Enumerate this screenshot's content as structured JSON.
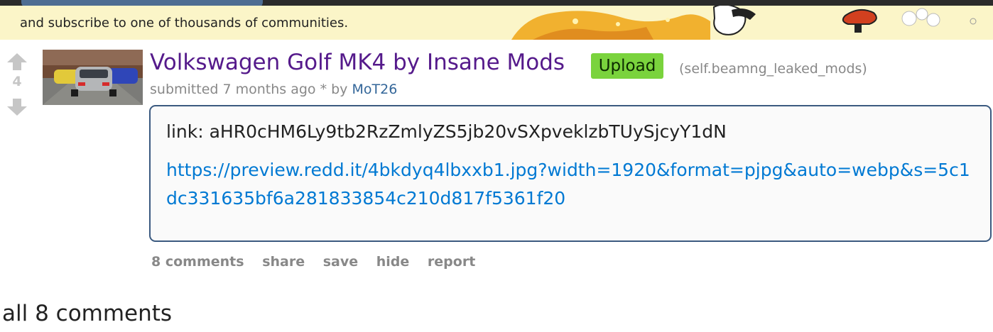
{
  "banner": {
    "text": "and subscribe to one of thousands of communities."
  },
  "post": {
    "score": "4",
    "title": "Volkswagen Golf MK4 by Insane Mods",
    "flair": "Upload",
    "domain": "self.beamng_leaked_mods",
    "tagline": {
      "prefix": "submitted 7 months ago * by",
      "author": "MoT26"
    },
    "body": {
      "line": "link: aHR0cHM6Ly9tb2RzZmlyZS5jb20vSXpveklzbTUySjcyY1dN",
      "link": "https://preview.redd.it/4bkdyq4lbxxb1.jpg?width=1920&format=pjpg&auto=webp&s=5c1dc331635bf6a281833854c210d817f5361f20"
    },
    "buttons": {
      "comments": "8 comments",
      "share": "share",
      "save": "save",
      "hide": "hide",
      "report": "report"
    }
  },
  "comments_header": "all 8 comments",
  "colors": {
    "title": "#551a8b",
    "link": "#0079d3",
    "flair": "#7ad33d",
    "banner": "#fbf5c8",
    "expando_border": "#3b5a80"
  }
}
